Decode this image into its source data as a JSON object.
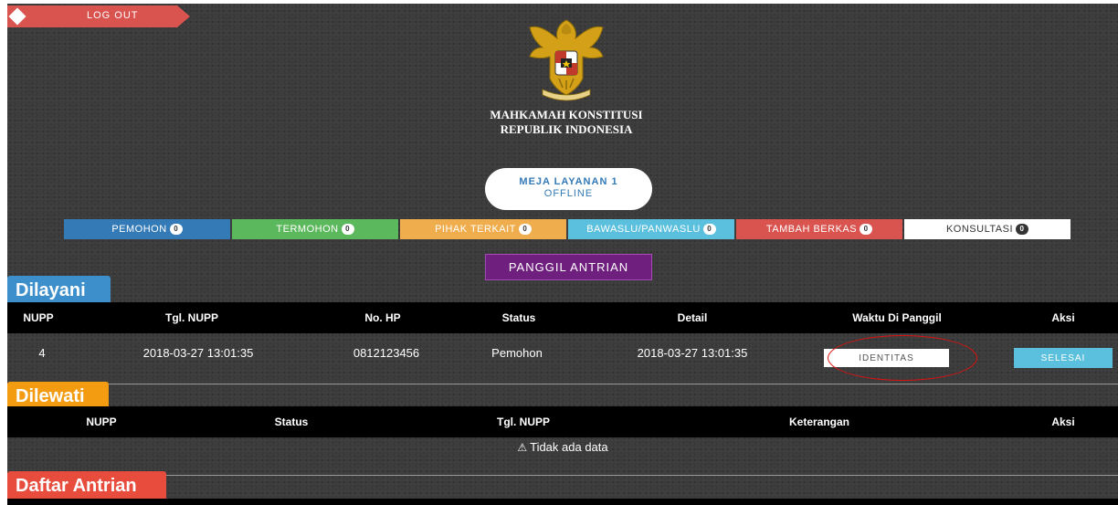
{
  "header": {
    "logout_label": "LOG OUT",
    "institution_line1": "MAHKAMAH KONSTITUSI",
    "institution_line2": "REPUBLIK INDONESIA"
  },
  "desk": {
    "name": "MEJA LAYANAN 1",
    "status": "OFFLINE"
  },
  "categories": [
    {
      "label": "PEMOHON",
      "count": "0",
      "color": "#337ab7"
    },
    {
      "label": "TERMOHON",
      "count": "0",
      "color": "#5cb85c"
    },
    {
      "label": "PIHAK TERKAIT",
      "count": "0",
      "color": "#f0ad4e"
    },
    {
      "label": "BAWASLU/PANWASLU",
      "count": "0",
      "color": "#5bc0de"
    },
    {
      "label": "TAMBAH BERKAS",
      "count": "0",
      "color": "#d9534f"
    },
    {
      "label": "KONSULTASI",
      "count": "0",
      "color": "#ffffff"
    }
  ],
  "call_button_label": "PANGGIL ANTRIAN",
  "served": {
    "title": "Dilayani",
    "columns": [
      "NUPP",
      "Tgl. NUPP",
      "No. HP",
      "Status",
      "Detail",
      "Waktu Di Panggil",
      "Aksi"
    ],
    "rows": [
      {
        "nupp": "4",
        "tgl_nupp": "2018-03-27 13:01:35",
        "no_hp": "0812123456",
        "status": "Pemohon",
        "detail": "2018-03-27 13:01:35",
        "identity_button": "IDENTITAS",
        "finish_button": "SELESAI"
      }
    ]
  },
  "skipped": {
    "title": "Dilewati",
    "columns": [
      "NUPP",
      "Status",
      "Tgl. NUPP",
      "Keterangan",
      "Aksi"
    ],
    "empty_message": "Tidak ada data"
  },
  "queue": {
    "title": "Daftar Antrian"
  },
  "colors": {
    "served_accent": "#3d8fcc",
    "skipped_accent": "#f39c12",
    "queue_accent": "#e74c3c",
    "call_button": "#6f1f7d"
  }
}
